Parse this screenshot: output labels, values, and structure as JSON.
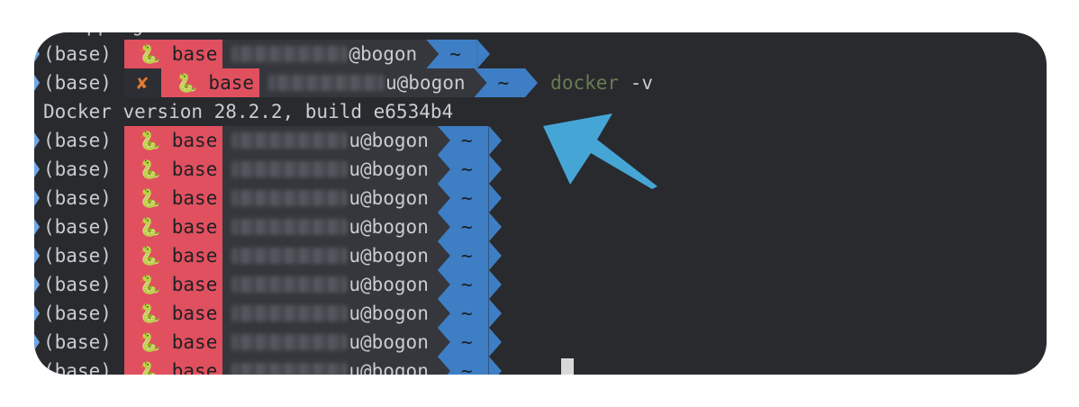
{
  "terminal": {
    "cutoff_line": "Stopping Non...",
    "prefix": "(base)",
    "env_name": "base",
    "host": "@bogon",
    "host_err": "u@bogon",
    "dir": "~",
    "error_mark": "✘",
    "command_name": "docker",
    "command_args": "-v",
    "output": "Docker version 28.2.2, build e6534b4",
    "row_count": 10
  },
  "colors": {
    "env_segment": "#e0505f",
    "user_segment": "#35373c",
    "dir_segment": "#3e7ec4",
    "arrow": "#45a6d6",
    "background": "#282a2e"
  },
  "icons": [
    "snake-icon",
    "prompt-caret-icon",
    "error-x-icon",
    "annotation-arrow-icon"
  ]
}
